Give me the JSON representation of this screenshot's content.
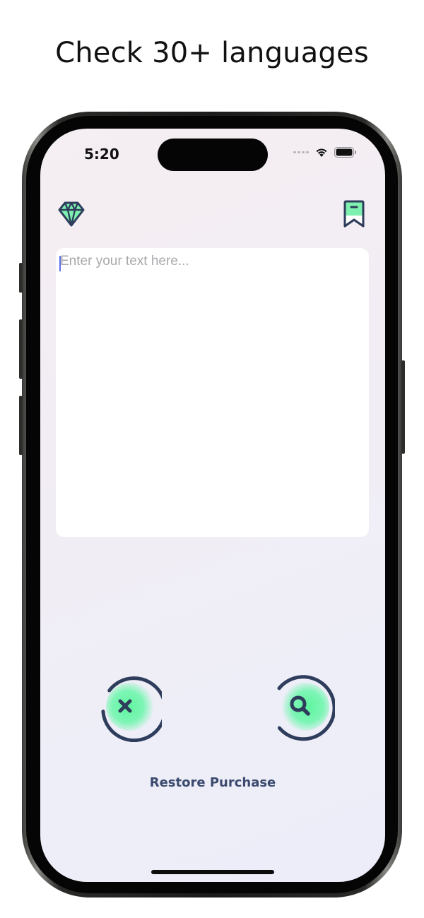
{
  "headline": "Check 30+ languages",
  "status_bar": {
    "time": "5:20"
  },
  "toolbar": {
    "left_icon": "diamond-icon",
    "right_icon": "bookmark-icon"
  },
  "editor": {
    "placeholder": "Enter your text here...",
    "value": ""
  },
  "actions": {
    "clear_icon": "close-icon",
    "check_icon": "search-icon"
  },
  "footer": {
    "restore_label": "Restore Purchase"
  },
  "colors": {
    "accent_green": "#6ef5a6",
    "icon_navy": "#2e3d5c",
    "text_label": "#3b4a6e"
  }
}
